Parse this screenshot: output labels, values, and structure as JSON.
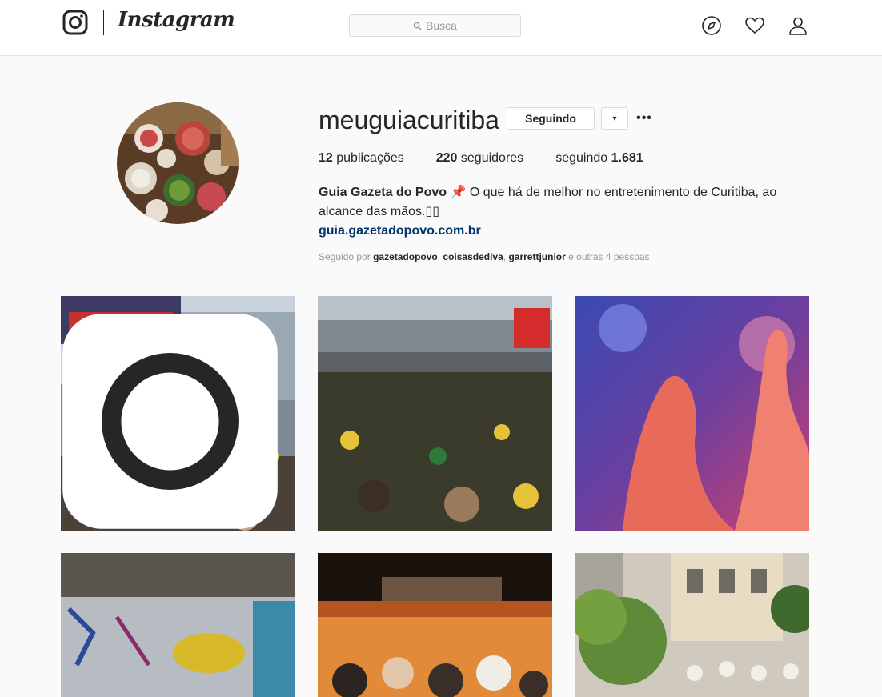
{
  "nav": {
    "brand": "Instagram",
    "search_placeholder": "Busca",
    "icons": [
      "instagram-glyph-icon",
      "search-icon",
      "compass-icon",
      "heart-icon",
      "user-icon"
    ]
  },
  "profile": {
    "username": "meuguiacuritiba",
    "follow_button": "Seguindo",
    "dropdown_symbol": "▾",
    "more_symbol": "•••",
    "stats": {
      "posts_count": "12",
      "posts_label": "publicações",
      "followers_count": "220",
      "followers_label": "seguidores",
      "following_label": "seguindo",
      "following_count": "1.681"
    },
    "bio": {
      "name": "Guia Gazeta do Povo",
      "pin": "📌",
      "text": "O que há de melhor no entretenimento de Curitiba, ao alcance das mãos.",
      "trailing_glyphs": "▯▯",
      "link": "guia.gazetadopovo.com.br"
    },
    "followed_by": {
      "prefix": "Seguido por",
      "user1": "gazetadopovo",
      "user2": "coisasdediva",
      "user3": "garrettjunior",
      "suffix": "e outras 4 pessoas"
    }
  },
  "colors": {
    "link": "#003569",
    "border": "#dbdbdb",
    "background": "#fafafa"
  }
}
